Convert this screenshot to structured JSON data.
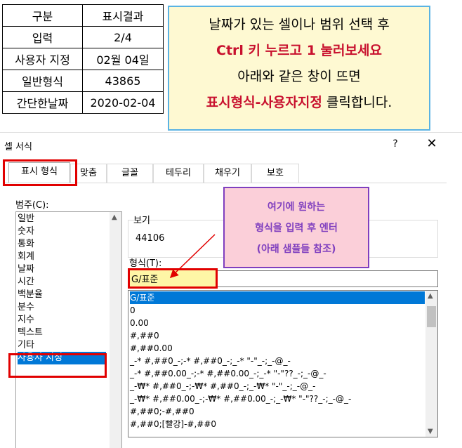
{
  "example_table": {
    "rows": [
      [
        "구분",
        "표시결과"
      ],
      [
        "입력",
        "2/4"
      ],
      [
        "사용자 지정",
        "02월 04일"
      ],
      [
        "일반형식",
        "43865"
      ],
      [
        "간단한날짜",
        "2020-02-04"
      ]
    ]
  },
  "instruction": {
    "line1": "날짜가 있는 셀이나 범위 선택 후",
    "line2": "Ctrl 키 누르고 1 눌러보세요",
    "line3": "아래와 같은 창이 뜨면",
    "line4_red": "표시형식-사용자지정",
    "line4_rest": " 클릭합니다."
  },
  "dialog": {
    "title": "셀 서식",
    "help": "?",
    "close": "✕",
    "tabs": [
      "표시 형식",
      "맞춤",
      "글꼴",
      "테두리",
      "채우기",
      "보호"
    ],
    "category_label": "범주(C):",
    "categories": [
      "일반",
      "숫자",
      "통화",
      "회계",
      "날짜",
      "시간",
      "백분율",
      "분수",
      "지수",
      "텍스트",
      "기타",
      "사용자 지정"
    ],
    "selected_category": "사용자 지정",
    "preview_label": "보기",
    "preview_value": "44106",
    "format_label": "형식(T):",
    "format_value": "G/표준",
    "formats": [
      "G/표준",
      "0",
      "0.00",
      "#,##0",
      "#,##0.00",
      "_-* #,##0_-;-* #,##0_-;_-* \"-\"_-;_-@_-",
      "_-* #,##0.00_-;-* #,##0.00_-;_-* \"-\"??_-;_-@_-",
      "_-₩* #,##0_-;-₩* #,##0_-;_-₩* \"-\"_-;_-@_-",
      "_-₩* #,##0.00_-;-₩* #,##0.00_-;_-₩* \"-\"??_-;_-@_-",
      "#,##0;-#,##0",
      "#,##0;[빨강]-#,##0"
    ]
  },
  "callout": {
    "line1": "여기에 원하는",
    "line2": "형식을 입력 후 엔터",
    "line3": "(아래 샘플들 참조)"
  },
  "colors": {
    "red": "#e10000",
    "instruction_red": "#c8102e",
    "callout_purple": "#7f3fbf",
    "selection_blue": "#0078d7"
  }
}
